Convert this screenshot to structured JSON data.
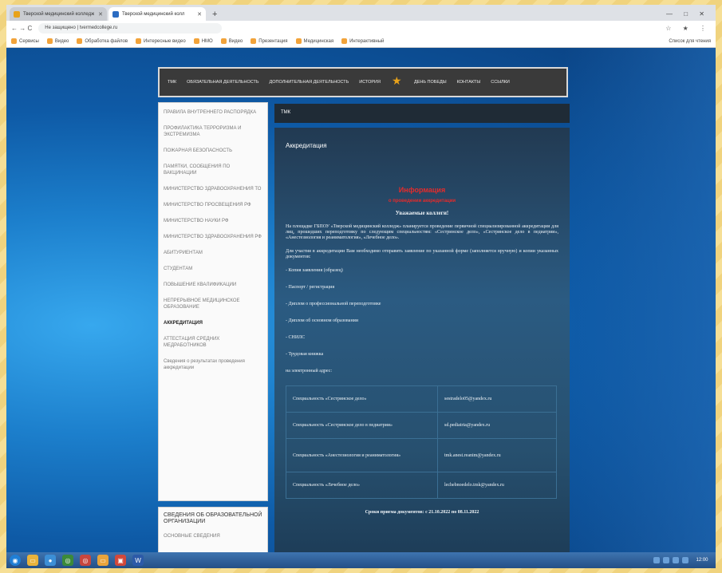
{
  "browser": {
    "tabs": [
      {
        "label": "Тверской медицинский колледж",
        "favicon_color": "#e8a21a",
        "active": false
      },
      {
        "label": "Тверской медицинский колл",
        "favicon_color": "#2b6cc2",
        "active": true
      }
    ],
    "new_tab_symbol": "+",
    "window_controls": "— □ ✕",
    "nav_symbols": "← → C",
    "url": "Не защищено | tvermedcollege.ru",
    "address_right": "☆ ★ ⋮",
    "bookmarks": [
      "Сервисы",
      "Видео",
      "Обработка файлов",
      "Интересные видео",
      "НМО",
      "Видео",
      "Презентация",
      "Медицинская",
      "Интерактивный"
    ],
    "bookmarks_right": "Список для чтения"
  },
  "site": {
    "nav": [
      "ТМК",
      "ОБЯЗАТЕЛЬНАЯ ДЕЯТЕЛЬНОСТЬ",
      "ДОПОЛНИТЕЛЬНАЯ ДЕЯТЕЛЬНОСТЬ",
      "ИСТОРИЯ",
      "ДЕНЬ ПОБЕДЫ",
      "КОНТАКТЫ",
      "ССЫЛКИ"
    ],
    "sidebar": [
      {
        "label": "Правила внутреннего распорядка",
        "current": false,
        "plain": false
      },
      {
        "label": "Профилактика терроризма и экстремизма",
        "current": false,
        "plain": false
      },
      {
        "label": "Пожарная безопасность",
        "current": false,
        "plain": false
      },
      {
        "label": "Памятки, сообщения по вакцинации",
        "current": false,
        "plain": false
      },
      {
        "label": "Министерство здравоохранения ТО",
        "current": false,
        "plain": false
      },
      {
        "label": "Министерство просвещения РФ",
        "current": false,
        "plain": false
      },
      {
        "label": "Министерство науки РФ",
        "current": false,
        "plain": false
      },
      {
        "label": "Министерство здравоохранения РФ",
        "current": false,
        "plain": false
      },
      {
        "label": "Абитуриентам",
        "current": false,
        "plain": false
      },
      {
        "label": "Студентам",
        "current": false,
        "plain": false
      },
      {
        "label": "Повышение квалификации",
        "current": false,
        "plain": false
      },
      {
        "label": "Непрерывное медицинское образование",
        "current": false,
        "plain": false
      },
      {
        "label": "Аккредитация",
        "current": true,
        "plain": false
      },
      {
        "label": "Аттестация средних медработников",
        "current": false,
        "plain": false
      },
      {
        "label": "Сведения о результатах проведения аккредитации",
        "current": false,
        "plain": true
      }
    ],
    "sidebar2": {
      "title": "Сведения об образовательной организации",
      "first_item": "Основные сведения"
    },
    "breadcrumb": "ТМК",
    "content": {
      "title": "Аккредитация",
      "red_line_1": "Информация",
      "red_line_2": "о проведении аккредитации",
      "greeting": "Уважаемые коллеги!",
      "paragraph_1": "На площадке ГБПОУ «Тверской медицинский колледж» планируется проведение первичной специализированной аккредитации для лиц, прошедших переподготовку по следующим специальностям: «Сестринское дело», «Сестринское дело в педиатрии», «Анестезиология и реаниматология», «Лечебное дело».",
      "paragraph_2": "Для участия в аккредитации Вам необходимо отправить заявление по указанной форме (заполняется вручную) и копии указанных документов:",
      "documents": [
        "- Копия заявления (образец)",
        "- Паспорт / регистрация",
        "- Диплом о профессиональной переподготовке",
        "- Диплом об основном образовании",
        "- СНИЛС",
        "- Трудовая книжка"
      ],
      "email_note": "на электронный адрес:",
      "specialties": [
        {
          "name": "Специальность «Сестринское дело»",
          "email": "sestradelo05@yandex.ru"
        },
        {
          "name": "Специальность «Сестринское дело в педиатрии»",
          "email": "sd.pediatria@yandex.ru"
        },
        {
          "name": "Специальность «Анестезиология и реаниматология»",
          "email": "tmk.anest.reanim@yandex.ru"
        },
        {
          "name": "Специальность «Лечебное дело»",
          "email": "lechebnoedelo.tmk@yandex.ru"
        }
      ],
      "dates": "Сроки приема документов: с 21.10.2022 по 08.11.2022"
    }
  },
  "taskbar": {
    "clock": "12:00"
  }
}
